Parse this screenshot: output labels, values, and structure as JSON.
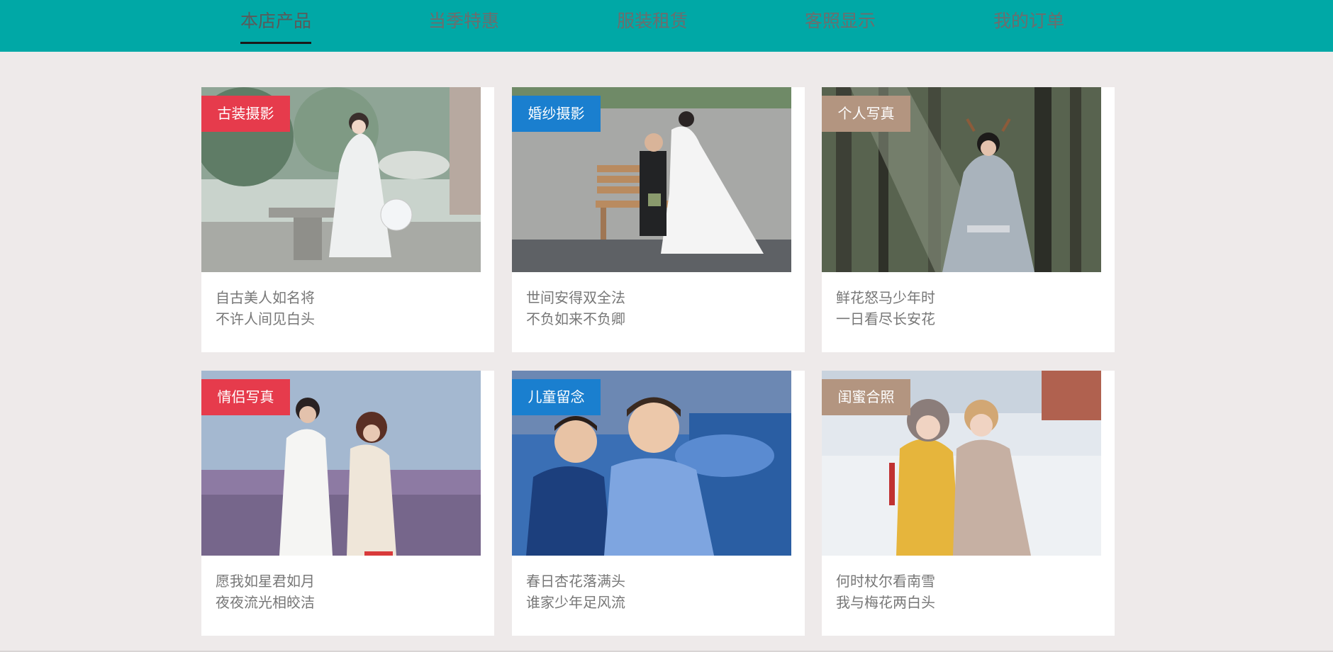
{
  "nav": {
    "items": [
      {
        "label": "本店产品",
        "active": true
      },
      {
        "label": "当季特惠",
        "active": false
      },
      {
        "label": "服装租赁",
        "active": false
      },
      {
        "label": "客照显示",
        "active": false
      },
      {
        "label": "我的订单",
        "active": false
      }
    ]
  },
  "cards": [
    {
      "tag": "古装摄影",
      "tag_color": "#e63b4c",
      "line1": "自古美人如名将",
      "line2": "不许人间见白头"
    },
    {
      "tag": "婚纱摄影",
      "tag_color": "#1a7fcf",
      "line1": "世间安得双全法",
      "line2": "不负如来不负卿"
    },
    {
      "tag": "个人写真",
      "tag_color": "#b39580",
      "line1": "鲜花怒马少年时",
      "line2": "一日看尽长安花"
    },
    {
      "tag": "情侣写真",
      "tag_color": "#e63b4c",
      "line1": "愿我如星君如月",
      "line2": "夜夜流光相皎洁"
    },
    {
      "tag": "儿童留念",
      "tag_color": "#1a7fcf",
      "line1": "春日杏花落满头",
      "line2": "谁家少年足风流"
    },
    {
      "tag": "闺蜜合照",
      "tag_color": "#b39580",
      "line1": "何时杖尔看南雪",
      "line2": "我与梅花两白头"
    }
  ],
  "colors": {
    "topbar": "#00a8a6",
    "page_bg": "#eeeaea",
    "card_bg": "#ffffff"
  }
}
